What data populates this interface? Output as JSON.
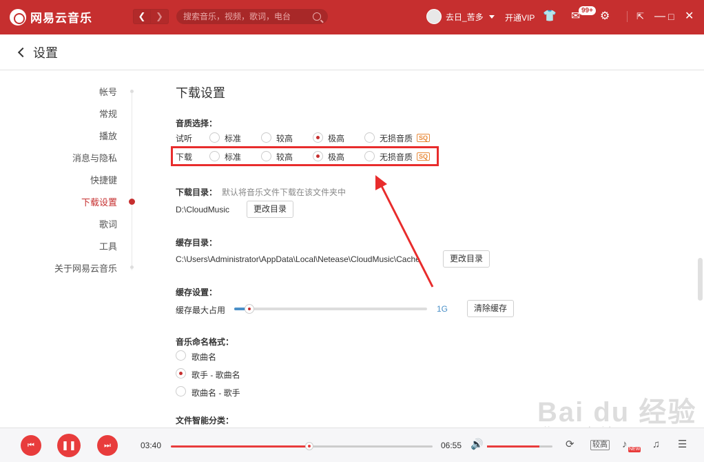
{
  "app": {
    "name": "网易云音乐",
    "search_placeholder": "搜索音乐，视频，歌词，电台",
    "user_name": "去日_苦多",
    "vip_label": "开通VIP",
    "message_badge": "99+"
  },
  "header": {
    "title": "设置"
  },
  "sidebar": {
    "items": [
      {
        "label": "帐号"
      },
      {
        "label": "常规"
      },
      {
        "label": "播放"
      },
      {
        "label": "消息与隐私"
      },
      {
        "label": "快捷键"
      },
      {
        "label": "下载设置"
      },
      {
        "label": "歌词"
      },
      {
        "label": "工具"
      },
      {
        "label": "关于网易云音乐"
      }
    ],
    "active": "下载设置"
  },
  "download": {
    "section_title": "下载设置",
    "quality": {
      "label": "音质选择：",
      "rows": [
        {
          "name": "试听",
          "selected": "极高"
        },
        {
          "name": "下载",
          "selected": "极高"
        }
      ],
      "options": [
        "标准",
        "较高",
        "极高",
        "无损音质"
      ],
      "sq_tag": "SQ"
    },
    "dir": {
      "label": "下载目录：",
      "hint": "默认将音乐文件下载在该文件夹中",
      "path": "D:\\CloudMusic",
      "button": "更改目录"
    },
    "cache_dir": {
      "label": "缓存目录：",
      "path": "C:\\Users\\Administrator\\AppData\\Local\\Netease\\CloudMusic\\Cache",
      "button": "更改目录"
    },
    "cache_setting": {
      "label": "缓存设置：",
      "max_label": "缓存最大占用",
      "value": "1G",
      "level": 0.08,
      "button": "清除缓存"
    },
    "naming": {
      "label": "音乐命名格式：",
      "options": [
        "歌曲名",
        "歌手 - 歌曲名",
        "歌曲名 - 歌手"
      ],
      "selected": "歌手 - 歌曲名"
    },
    "smart_label": "文件智能分类："
  },
  "player": {
    "current_time": "03:40",
    "total_time": "06:55",
    "progress": 0.53,
    "volume": 0.8,
    "quality": "较高",
    "new_tag": "NEW"
  },
  "watermark": {
    "main": "Bai du 经验",
    "sub": "jingyan.baidu.com"
  },
  "colors": {
    "brand": "#c62f2f",
    "accent_blue": "#4a90c8",
    "annotation": "#e82c2c"
  }
}
